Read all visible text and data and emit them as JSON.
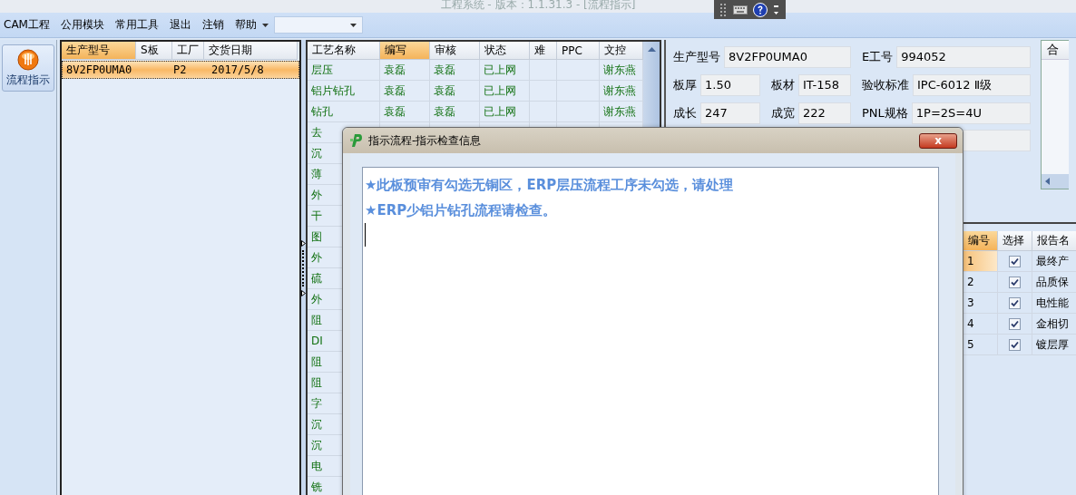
{
  "window": {
    "title": "工程系统 - 版本：1.1.31.3 - [流程指示]"
  },
  "menu": [
    "CAM工程",
    "公用模块",
    "常用工具",
    "退出",
    "注销",
    "帮助"
  ],
  "nav": [
    {
      "label": "流程指示",
      "selected": true
    }
  ],
  "product_list": {
    "columns": [
      {
        "label": "生产型号",
        "sorted": true
      },
      {
        "label": "S板",
        "sorted": false
      },
      {
        "label": "工厂",
        "sorted": false
      },
      {
        "label": "交货日期",
        "sorted": false
      }
    ],
    "rows": [
      {
        "cells": [
          "8V2FP0UMA0",
          "",
          "P2",
          "2017/5/8"
        ],
        "selected": true
      }
    ]
  },
  "process_table": {
    "columns": [
      {
        "label": "工艺名称",
        "sorted": false
      },
      {
        "label": "编写",
        "sorted": true
      },
      {
        "label": "审核",
        "sorted": false
      },
      {
        "label": "状态",
        "sorted": false
      },
      {
        "label": "难",
        "sorted": false
      },
      {
        "label": "PPC",
        "sorted": false
      },
      {
        "label": "文控",
        "sorted": false
      }
    ],
    "rows": [
      {
        "cells": [
          "层压",
          "袁磊",
          "袁磊",
          "已上网",
          "",
          "",
          "谢东燕"
        ]
      },
      {
        "cells": [
          "铝片钻孔",
          "袁磊",
          "袁磊",
          "已上网",
          "",
          "",
          "谢东燕"
        ]
      },
      {
        "cells": [
          "钻孔",
          "袁磊",
          "袁磊",
          "已上网",
          "",
          "",
          "谢东燕"
        ]
      },
      {
        "cells": [
          "去"
        ]
      },
      {
        "cells": [
          "沉"
        ]
      },
      {
        "cells": [
          "薄"
        ]
      },
      {
        "cells": [
          "外"
        ]
      },
      {
        "cells": [
          "干"
        ]
      },
      {
        "cells": [
          "图"
        ]
      },
      {
        "cells": [
          "外"
        ]
      },
      {
        "cells": [
          "硫"
        ]
      },
      {
        "cells": [
          "外"
        ]
      },
      {
        "cells": [
          "阻"
        ]
      },
      {
        "cells": [
          "DI"
        ]
      },
      {
        "cells": [
          "阻"
        ]
      },
      {
        "cells": [
          "阻"
        ]
      },
      {
        "cells": [
          "字"
        ]
      },
      {
        "cells": [
          "沉"
        ]
      },
      {
        "cells": [
          "沉"
        ]
      },
      {
        "cells": [
          "电"
        ]
      },
      {
        "cells": [
          "铣"
        ]
      }
    ]
  },
  "form": {
    "fields": [
      {
        "label": "生产型号",
        "value": "8V2FP0UMA0"
      },
      {
        "label": "E工号",
        "value": "994052"
      },
      {
        "label": "板厚",
        "value": "1.50"
      },
      {
        "label": "板材",
        "value": "IT-158"
      },
      {
        "label": "验收标准",
        "value": "IPC-6012 Ⅱ级"
      },
      {
        "label": "成长",
        "value": "247"
      },
      {
        "label": "成宽",
        "value": "222"
      },
      {
        "label": "PNL规格",
        "value": "1P=2S=4U"
      }
    ]
  },
  "side_panel": {
    "header": "合"
  },
  "report_table": {
    "columns": [
      {
        "label": "编号",
        "sorted": true
      },
      {
        "label": "选择",
        "sorted": false
      },
      {
        "label": "报告名",
        "sorted": false
      }
    ],
    "rows": [
      {
        "no": "1",
        "checked": true,
        "name": "最终产",
        "selected": true
      },
      {
        "no": "2",
        "checked": true,
        "name": "品质保",
        "selected": false
      },
      {
        "no": "3",
        "checked": true,
        "name": "电性能",
        "selected": false
      },
      {
        "no": "4",
        "checked": true,
        "name": "金相切",
        "selected": false
      },
      {
        "no": "5",
        "checked": true,
        "name": "镀层厚",
        "selected": false
      }
    ]
  },
  "dialog": {
    "title": "指示流程-指示检查信息",
    "close": "x",
    "messages": [
      "★此板预审有勾选无铜区，ERP层压流程工序未勾选，请处理",
      "★ERP少铝片钻孔流程请检查。"
    ]
  }
}
